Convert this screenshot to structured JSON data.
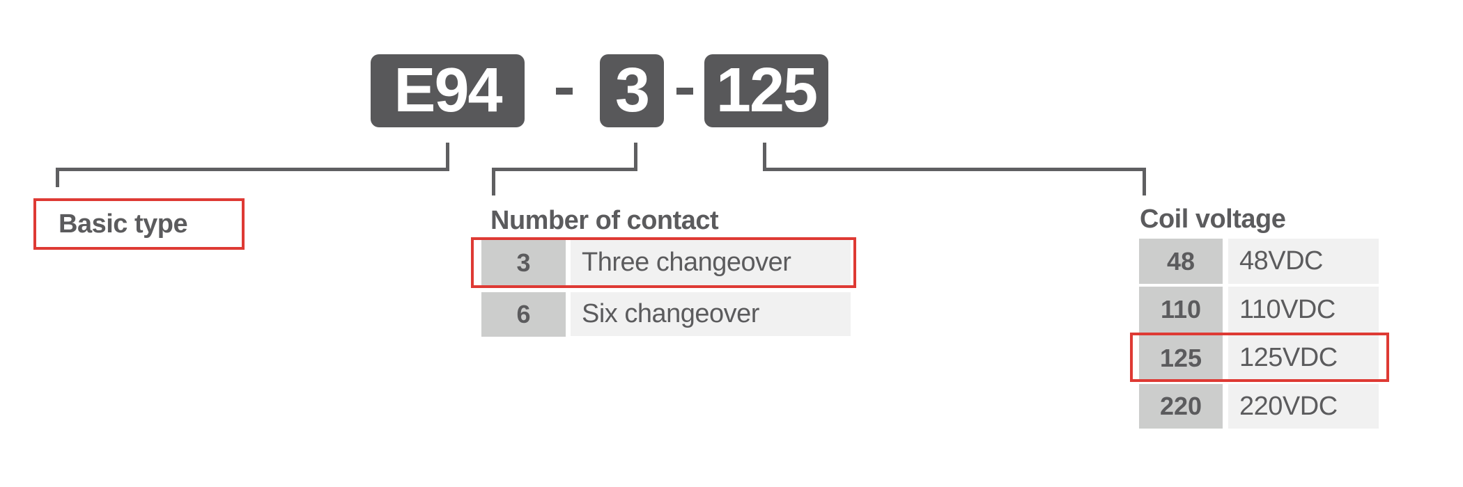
{
  "code": {
    "segments": [
      "E94",
      "3",
      "125"
    ],
    "separator": "-"
  },
  "basic_type": {
    "label": "Basic type"
  },
  "contacts": {
    "heading": "Number of contact",
    "rows": [
      {
        "code": "3",
        "description": "Three changeover",
        "selected": true
      },
      {
        "code": "6",
        "description": "Six changeover",
        "selected": false
      }
    ]
  },
  "coil": {
    "heading": "Coil voltage",
    "rows": [
      {
        "code": "48",
        "description": "48VDC",
        "selected": false
      },
      {
        "code": "110",
        "description": "110VDC",
        "selected": false
      },
      {
        "code": "125",
        "description": "125VDC",
        "selected": true
      },
      {
        "code": "220",
        "description": "220VDC",
        "selected": false
      }
    ]
  },
  "colors": {
    "segment_bg": "#58585a",
    "highlight": "#de3a34",
    "code_cell": "#cccdcc",
    "desc_cell": "#f1f1f1",
    "text": "#5b5b5d"
  }
}
